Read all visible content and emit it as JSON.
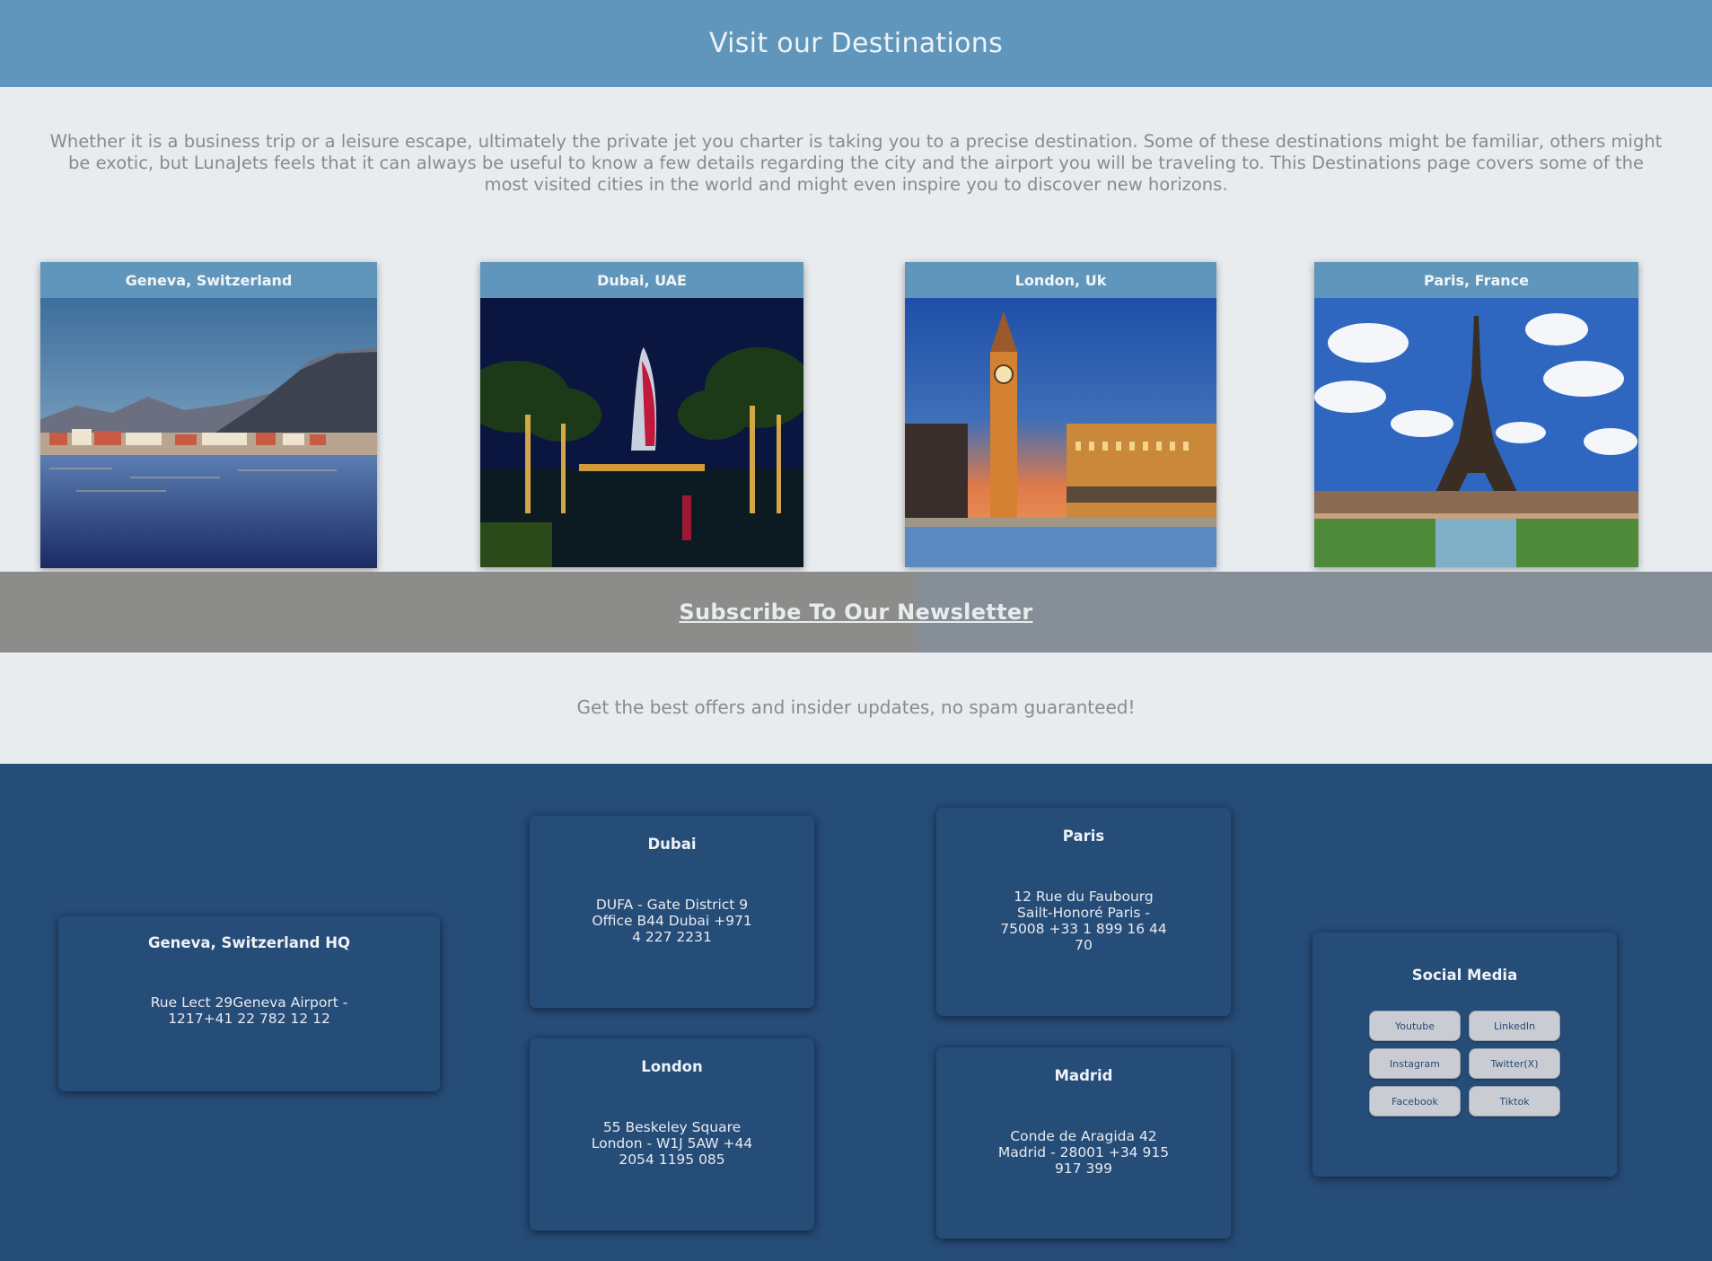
{
  "header": {
    "title": "Visit our Destinations"
  },
  "intro": {
    "text": "Whether it is a business trip or a leisure escape, ultimately the private jet you charter is taking you to a precise destination. Some of these destinations might be familiar, others might be exotic, but LunaJets feels that it can always be useful to know a few details regarding the city and the airport you will be traveling to. This Destinations page covers some of the most visited cities in the world and might even inspire you to discover new horizons."
  },
  "destinations": [
    {
      "title": "Geneva, Switzerland"
    },
    {
      "title": "Dubai, UAE"
    },
    {
      "title": "London, Uk"
    },
    {
      "title": "Paris, France"
    }
  ],
  "newsletter": {
    "link_label": "Subscribe To Our Newsletter",
    "subtitle": "Get the best offers and insider updates, no spam guaranteed!"
  },
  "offices": {
    "geneva": {
      "title": "Geneva, Switzerland HQ",
      "lines": [
        "Rue Lect 29Geneva Airport -",
        "1217+41 22 782 12 12"
      ]
    },
    "dubai": {
      "title": "Dubai",
      "lines": [
        "DUFA - Gate District 9",
        "Office B44 Dubai +971",
        "4 227 2231"
      ]
    },
    "london": {
      "title": "London",
      "lines": [
        "55 Beskeley Square",
        "London - W1J 5AW +44",
        "2054 1195 085"
      ]
    },
    "paris": {
      "title": "Paris",
      "lines": [
        "12 Rue du Faubourg",
        "Sailt-Honoré Paris -",
        "75008 +33 1 899 16 44",
        "70"
      ]
    },
    "madrid": {
      "title": "Madrid",
      "lines": [
        "Conde de Aragida 42",
        "Madrid - 28001 +34 915",
        "917 399"
      ]
    }
  },
  "social": {
    "title": "Social Media",
    "buttons": [
      "Youtube",
      "LinkedIn",
      "Instagram",
      "Twitter(X)",
      "Facebook",
      "Tiktok"
    ]
  },
  "colors": {
    "header_blue": "#6096bb",
    "footer_navy": "#264c78",
    "page_bg": "#e8ecef"
  }
}
